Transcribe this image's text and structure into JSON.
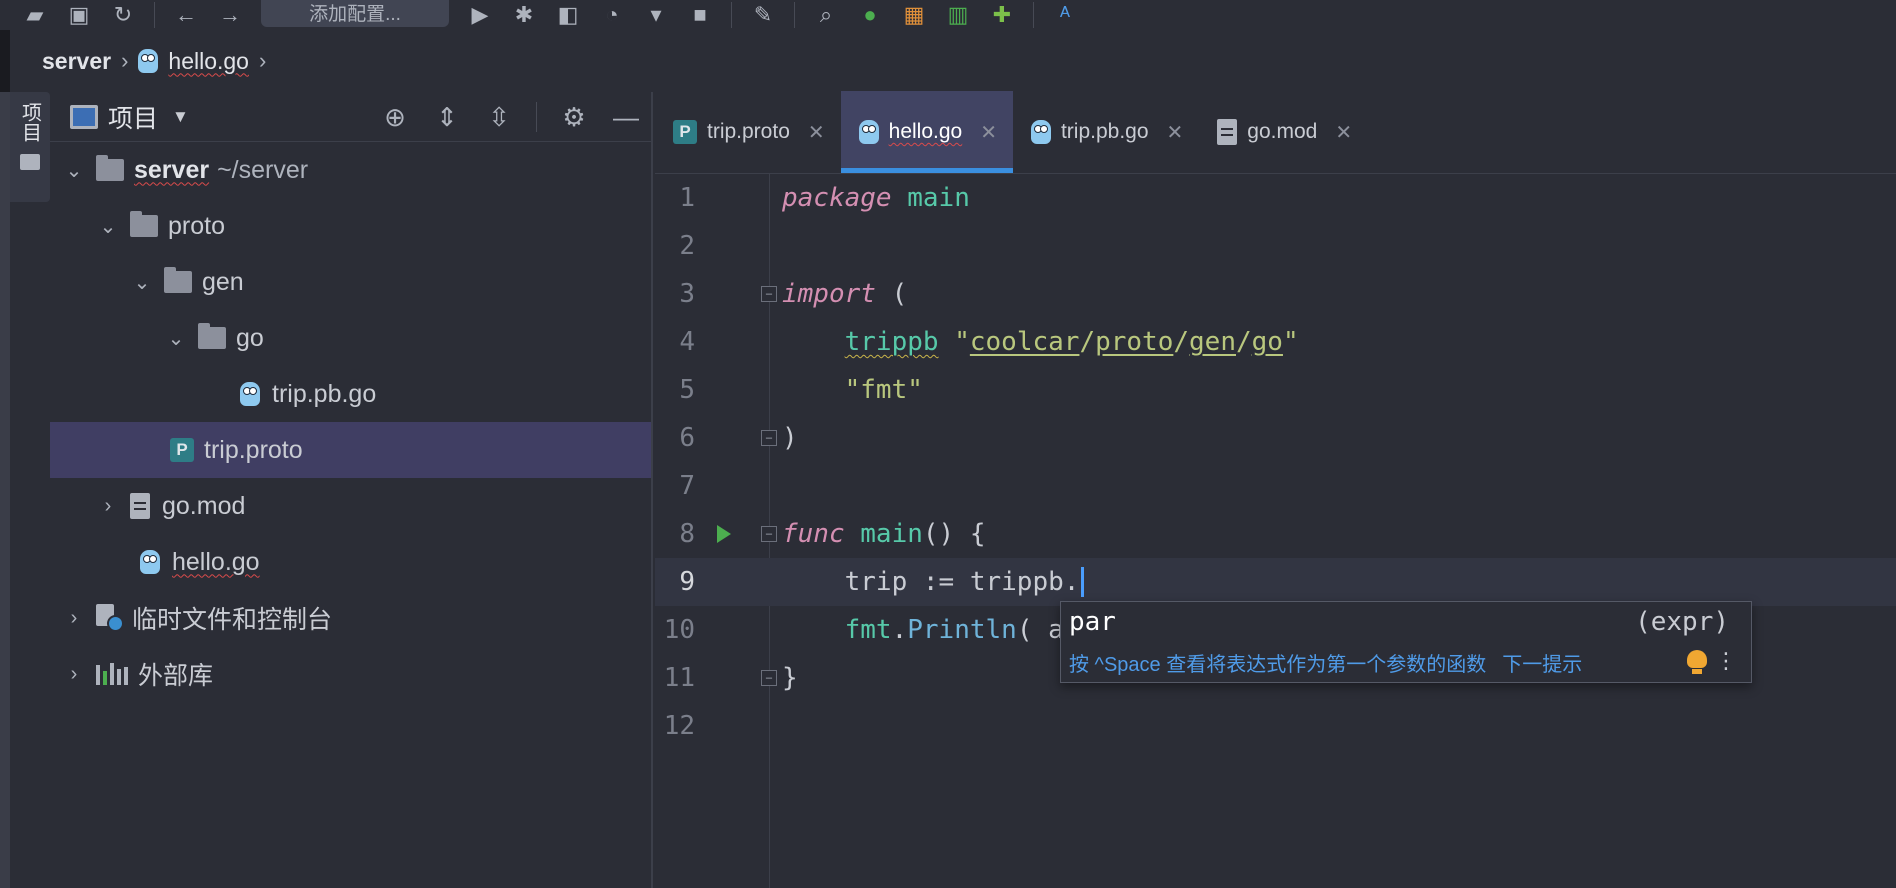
{
  "toolbar": {
    "config_label": "添加配置...",
    "icons": [
      "open-folder-icon",
      "save-icon",
      "sync-icon",
      "back-icon",
      "forward-icon",
      "run-icon",
      "debug-icon",
      "coverage-icon",
      "profile-icon",
      "stop-icon",
      "settings-wrench-icon",
      "search-icon",
      "vcs-icon",
      "plugin-icon",
      "database-icon",
      "puzzle-icon",
      "translate-icon"
    ]
  },
  "breadcrumb": {
    "root": "server",
    "file": "hello.go"
  },
  "side_strip": {
    "label": "项目"
  },
  "project_panel": {
    "title": "项目",
    "tree": {
      "server_name": "server",
      "server_path": "~/server",
      "proto": "proto",
      "gen": "gen",
      "go": "go",
      "trip_pb_go": "trip.pb.go",
      "trip_proto": "trip.proto",
      "go_mod": "go.mod",
      "hello_go": "hello.go",
      "scratches": "临时文件和控制台",
      "external_libs": "外部库"
    }
  },
  "tabs": [
    {
      "label": "trip.proto",
      "icon": "proto-file-icon",
      "active": false
    },
    {
      "label": "hello.go",
      "icon": "gopher-icon",
      "active": true
    },
    {
      "label": "trip.pb.go",
      "icon": "gopher-icon",
      "active": false
    },
    {
      "label": "go.mod",
      "icon": "mod-file-icon",
      "active": false
    }
  ],
  "code": {
    "line_numbers": [
      "1",
      "2",
      "3",
      "4",
      "5",
      "6",
      "7",
      "8",
      "9",
      "10",
      "11",
      "12"
    ],
    "l1_kw": "package",
    "l1_name": "main",
    "l3_kw": "import",
    "l3_paren": " (",
    "l4_alias": "trippb",
    "l4_q1": " \"",
    "l4_p1": "coolcar",
    "l4_s1": "/",
    "l4_p2": "proto",
    "l4_s2": "/",
    "l4_p3": "gen",
    "l4_s3": "/",
    "l4_p4": "go",
    "l4_q2": "\"",
    "l5_str": "\"fmt\"",
    "l6_close": ")",
    "l8_kw": "func",
    "l8_name": "main",
    "l8_rest": "() {",
    "l9_text": "trip := trippb.",
    "l10_pkg": "fmt",
    "l10_dot": ".",
    "l10_fn": "Println",
    "l10_rest": "( a",
    "l11_close": "}"
  },
  "completion": {
    "item": "par",
    "item_tail": "(expr)",
    "hint": "按 ^Space 查看将表达式作为第一个参数的函数",
    "next": "下一提示"
  }
}
